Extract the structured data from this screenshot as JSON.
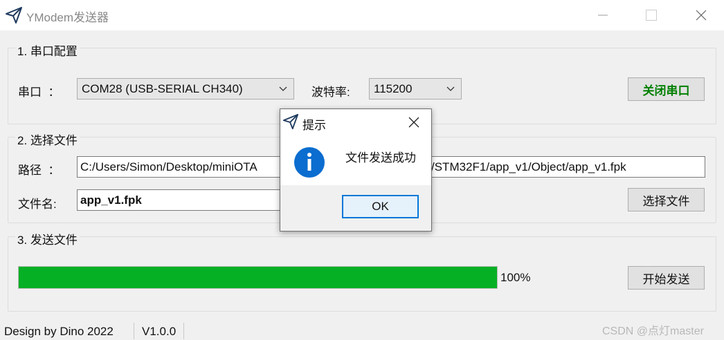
{
  "window": {
    "title": "YModem发送器",
    "icon": "send-arrow-icon",
    "controls": [
      "minimize-icon",
      "maximize-icon",
      "close-icon"
    ]
  },
  "serial_group": {
    "title": "1. 串口配置",
    "port_label": "串口  ：",
    "port_value": "COM28 (USB-SERIAL CH340)",
    "baud_label": "波特率:",
    "baud_value": "115200",
    "toggle_button": "关闭串口",
    "toggle_button_color": "#008000"
  },
  "file_group": {
    "title": "2. 选择文件",
    "path_label": "路径  ：",
    "path_value": "C:/Users/Simon/Desktop/miniOTA/STM32F1/app_v1/Object/app_v1.fpk",
    "path_visible_left": "C:/Users/Simon/Desktop/miniOTA",
    "path_visible_right": "/STM32F1/app_v1/Object/app_v1.fpk",
    "filename_label": "文件名:",
    "filename_value": "app_v1.fpk",
    "choose_button": "选择文件"
  },
  "send_group": {
    "title": "3. 发送文件",
    "progress_percent": 100,
    "progress_text": "100%",
    "progress_color": "#06b025",
    "send_button": "开始发送"
  },
  "status_bar": {
    "author": "Design by Dino 2022",
    "version": "V1.0.0"
  },
  "dialog": {
    "title": "提示",
    "icon": "info-icon",
    "message": "文件发送成功",
    "ok_button": "OK",
    "accent_color": "#0078d7"
  },
  "watermark": "CSDN @点灯master"
}
